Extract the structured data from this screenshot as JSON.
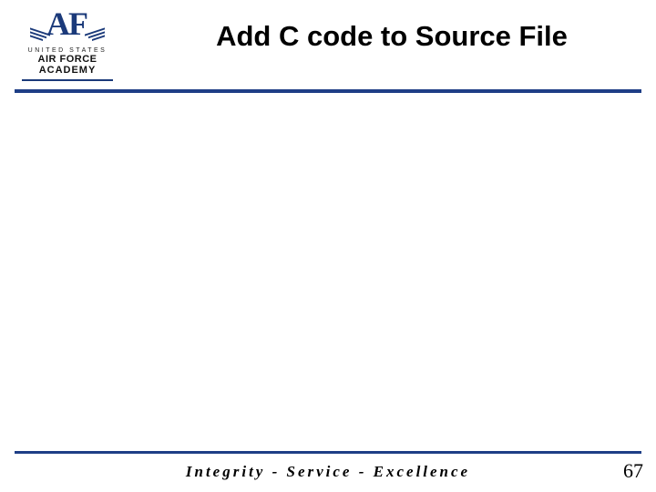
{
  "logo": {
    "monogram_a": "A",
    "monogram_f": "F",
    "subscript": "UNITED STATES",
    "line1": "AIR FORCE",
    "line2": "ACADEMY"
  },
  "title": "Add C code to Source File",
  "motto": "Integrity - Service - Excellence",
  "page_number": "67"
}
